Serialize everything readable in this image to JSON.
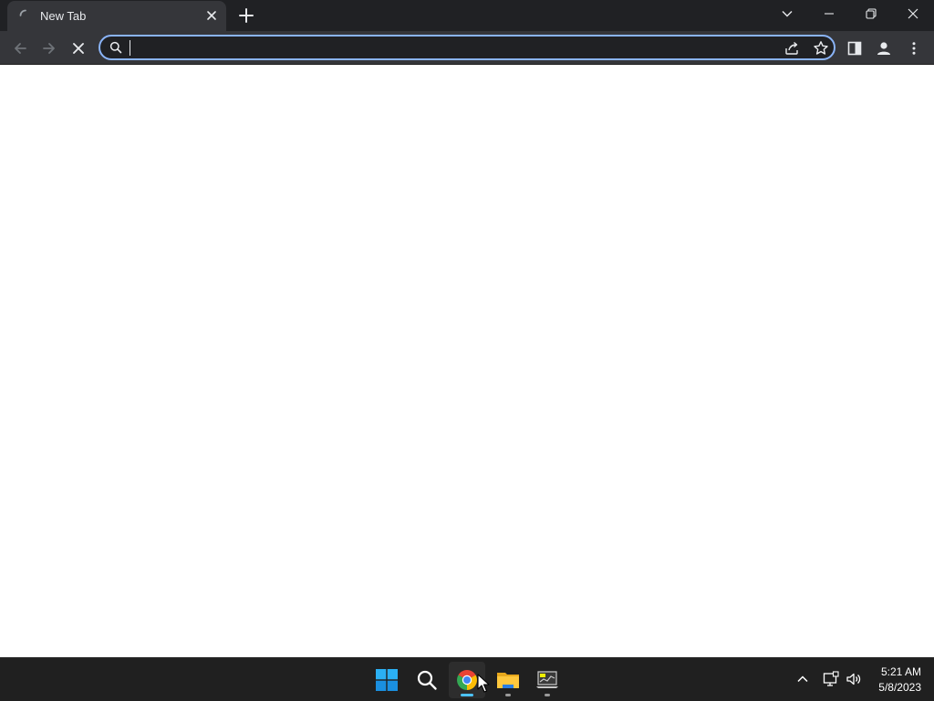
{
  "browser": {
    "tab": {
      "title": "New Tab"
    },
    "omnibox": {
      "value": "",
      "placeholder": ""
    }
  },
  "icons": {
    "back": "arrow-left-icon",
    "forward": "arrow-right-icon",
    "stop": "close-icon",
    "search": "search-icon",
    "share": "share-icon",
    "bookmark": "star-icon",
    "side_panel": "side-panel-icon",
    "profile": "person-icon",
    "menu": "kebab-menu-icon"
  },
  "taskbar": {
    "apps": [
      "Start",
      "Search",
      "Google Chrome",
      "File Explorer",
      "Performance Monitor"
    ],
    "clock": {
      "time": "5:21 AM",
      "date": "5/8/2023"
    }
  },
  "colors": {
    "titlebar": "#202124",
    "toolbar": "#35363a",
    "focus_ring": "#8ab4f8",
    "taskbar": "#202020",
    "active_indicator": "#4cc2ff"
  }
}
